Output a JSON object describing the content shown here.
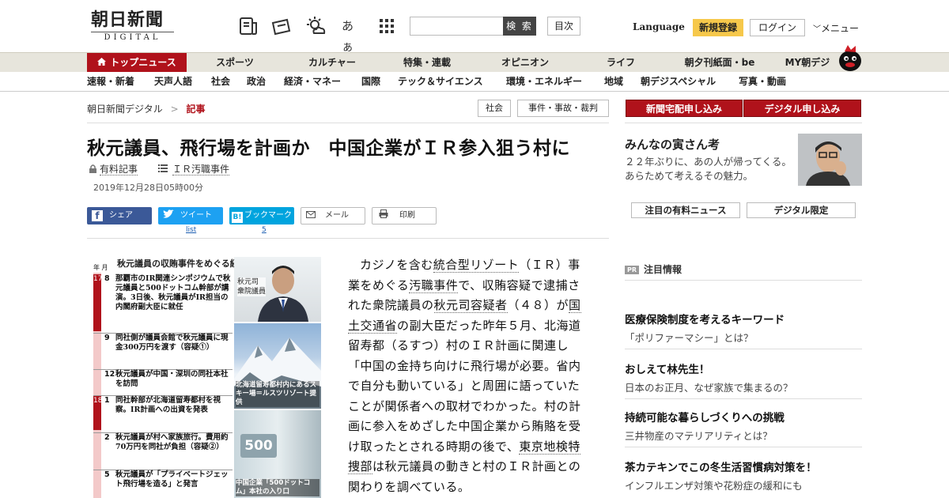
{
  "header": {
    "logo_main": "朝日新聞",
    "logo_sub": "DIGITAL",
    "icons": [
      "newspaper-icon",
      "coupon-icon",
      "weather-icon",
      "font-size-icon",
      "apps-grid-icon"
    ],
    "font_icon_label": "あぁ",
    "search_placeholder": "",
    "search_button": "検 索",
    "contents_button": "目次",
    "language": "Language",
    "register": "新規登録",
    "login": "ログイン",
    "menu": "メニュー"
  },
  "nav_primary": [
    "トップニュース",
    "スポーツ",
    "カルチャー",
    "特集・連載",
    "オピニオン",
    "ライフ",
    "朝夕刊紙面・be",
    "MY朝デジ"
  ],
  "nav_secondary": [
    "速報・新着",
    "天声人語",
    "社会",
    "政治",
    "経済・マネー",
    "国際",
    "テック＆サイエンス",
    "環境・エネルギー",
    "地域",
    "朝デジスペシャル",
    "写真・動画"
  ],
  "breadcrumb": {
    "home": "朝日新聞デジタル",
    "sep": ">",
    "current": "記事"
  },
  "tags": [
    "社会",
    "事件・事故・裁判"
  ],
  "article": {
    "title": "秋元議員、飛行場を計画か　中国企業がＩＲ参入狙う村に",
    "paid_label": "有料記事",
    "series_label": "ＩＲ汚職事件",
    "date": "2019年12月28日05時00分",
    "share": [
      {
        "label": "シェア",
        "count": ""
      },
      {
        "label": "ツイート",
        "count": "list"
      },
      {
        "label": "ブックマーク",
        "count": "5"
      },
      {
        "label": "メール",
        "count": ""
      },
      {
        "label": "印刷",
        "count": ""
      }
    ],
    "body": [
      {
        "t": "カジノを含む",
        "u": false
      },
      {
        "t": "統合型リゾート",
        "u": true
      },
      {
        "t": "（ＩＲ）事業をめぐる",
        "u": false
      },
      {
        "t": "汚職事件",
        "u": true
      },
      {
        "t": "で、収賄容疑で逮捕された衆院議員の",
        "u": false
      },
      {
        "t": "秋元司容疑者",
        "u": true
      },
      {
        "t": "（４８）が",
        "u": false
      },
      {
        "t": "国土交通省",
        "u": true
      },
      {
        "t": "の副大臣だった昨年５月、北海道留寿都（るすつ）村のＩＲ計画に関連し「中国の金持ち向けに飛行場が必要。省内で自分も動いている」と周囲に語っていたことが関係者への取材でわかった。村の計画に参入をめざした中国企業から賄賂を受け取ったとされる時期の後で、",
        "u": false
      },
      {
        "t": "東京地検特捜部",
        "u": true
      },
      {
        "t": "は秋元議員の動きと村のＩＲ計画との関わりを調べている。",
        "u": false
      }
    ]
  },
  "figure": {
    "title": "秋元議員の収賄事件をめぐる経緯",
    "year_label": "年",
    "month_label": "月",
    "rows": [
      {
        "year": "17",
        "month": "8",
        "text": "那覇市のIR関連シンポジウムで秋元議員と500ドットコム幹部が講演。3日後、秋元議員がIR担当の内閣府副大臣に就任"
      },
      {
        "year": "",
        "month": "9",
        "text": "同社側が議員会館で秋元議員に現金300万円を渡す（容疑①）"
      },
      {
        "year": "",
        "month": "12",
        "text": "秋元議員が中国・深圳の同社本社を訪問"
      },
      {
        "year": "18",
        "month": "1",
        "text": "同社幹部が北海道留寿都村を視察。IR計画への出資を発表"
      },
      {
        "year": "",
        "month": "2",
        "text": "秋元議員が村へ家族旅行。費用約70万円を同社が負担（容疑②）"
      },
      {
        "year": "",
        "month": "5",
        "text": "秋元議員が「プライベートジェット飛行場を造る」と発言"
      }
    ],
    "photo1_caption": "秋元司 衆院議員",
    "photo2_caption": "北海道留寿都村内にあるスキー場＝ルスツリゾート提供",
    "photo3_logo": "500",
    "photo3_caption": "中国企業「500ドットコム」本社の入り口"
  },
  "sidebar": {
    "buttons": [
      "新聞宅配申し込み",
      "デジタル申し込み"
    ],
    "promo": {
      "title": "みんなの寅さん考",
      "desc": "２２年ぶりに、あの人が帰ってくる。あらためて考えるその魅力。"
    },
    "tabs": [
      "注目の有料ニュース",
      "デジタル限定"
    ],
    "pr_badge": "PR",
    "pr_heading": "注目情報",
    "ads": [
      {
        "h": "医療保険制度を考えるキーワード",
        "s": "「ポリファーマシー」とは？"
      },
      {
        "h": "おしえて林先生！",
        "s": "日本のお正月、なぜ家族で集まるの？"
      },
      {
        "h": "持続可能な暮らしづくりへの挑戦",
        "s": "三井物産のマテリアリティとは？"
      },
      {
        "h": "茶カテキンでこの冬生活習慣病対策を！",
        "s": "インフルエンザ対策や花粉症の緩和にも"
      }
    ]
  },
  "colors": {
    "brand_red": "#b0121b",
    "nav_bg": "#e7e5dc",
    "register_yellow": "#f6c84b",
    "facebook": "#3b5998",
    "twitter": "#1da1f2",
    "hatena": "#00a4de"
  }
}
